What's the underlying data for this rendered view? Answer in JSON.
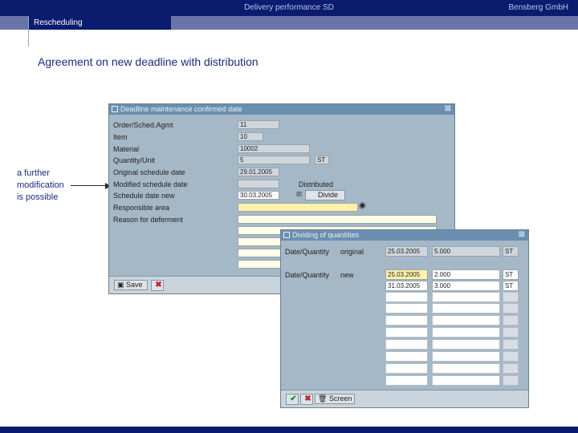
{
  "header": {
    "center_title": "Delivery performance SD",
    "company": "Bensberg GmbH",
    "section": "Rescheduling"
  },
  "headline": "Agreement on new deadline with distribution",
  "annotation": [
    "a further",
    "modification",
    "is possible"
  ],
  "window1": {
    "title": "Deadline maintenance confirmed date",
    "fields": [
      {
        "label": "Order/Sched.Agmt",
        "value": "11"
      },
      {
        "label": "Item",
        "value": "10"
      },
      {
        "label": "Material",
        "value": "10002"
      },
      {
        "label": "Quantity/Unit",
        "value": "5",
        "unit": "ST"
      },
      {
        "label": "Original schedule date",
        "value": "29.01.2005"
      },
      {
        "label": "Modified schedule date",
        "value": ""
      },
      {
        "label": "Schedule date new",
        "value": "30.03.2005"
      },
      {
        "label": "Responsible area",
        "value": ""
      },
      {
        "label": "Reason for deferment",
        "value": ""
      }
    ],
    "distributed_label": "Distributed",
    "divide_button": "Divide",
    "save_button": "Save"
  },
  "window2": {
    "title": "Dividing of quantities",
    "rows": [
      {
        "label": "Date/Quantity",
        "tag": "original",
        "date": "25.03.2005",
        "qty": "5.000",
        "unit": "ST"
      },
      {
        "label": "Date/Quantity",
        "tag": "new",
        "date": "25.03.2005",
        "qty": "2.000",
        "unit": "ST"
      },
      {
        "label": "",
        "tag": "",
        "date": "31.03.2005",
        "qty": "3.000",
        "unit": "ST"
      }
    ],
    "screen_button": "Screen"
  }
}
